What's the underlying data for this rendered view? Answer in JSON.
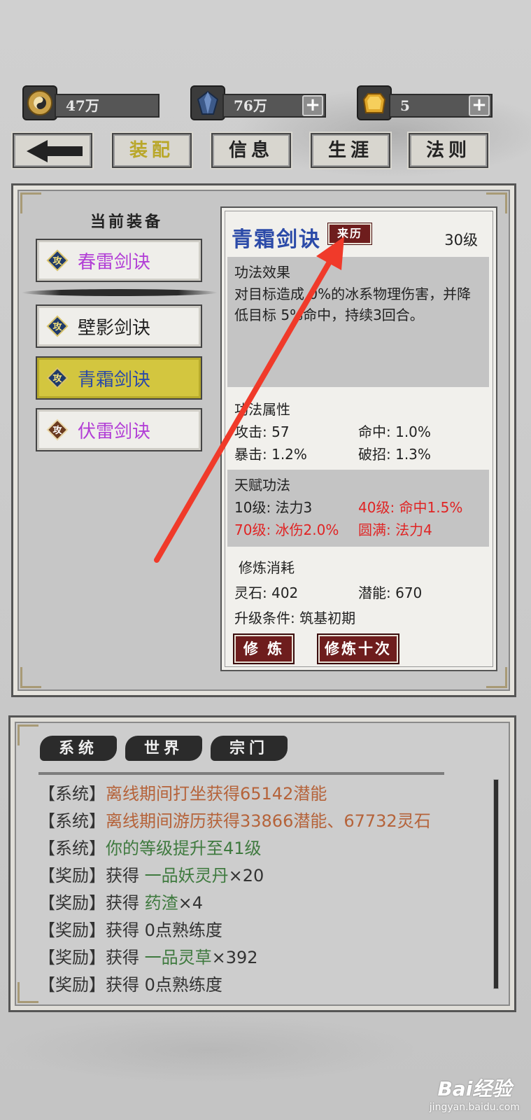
{
  "resources": [
    {
      "icon": "taiji-icon",
      "value": "47万",
      "has_plus": false
    },
    {
      "icon": "crystal-icon",
      "value": "76万",
      "has_plus": true
    },
    {
      "icon": "gold-gem-icon",
      "value": "5",
      "has_plus": true
    }
  ],
  "nav": {
    "equip": "装配",
    "info": "信息",
    "career": "生涯",
    "rules": "法则"
  },
  "equip_panel": {
    "title": "当前装备",
    "skills": [
      {
        "name": "春雷剑诀",
        "badge": "攻",
        "color": "#b23fd6",
        "selected": false
      },
      {
        "name": "壁影剑诀",
        "badge": "攻",
        "color": "#222222",
        "selected": false
      },
      {
        "name": "青霜剑诀",
        "badge": "攻",
        "color": "#2b4aa8",
        "selected": true
      },
      {
        "name": "伏雷剑诀",
        "badge": "攻",
        "color": "#b23fd6",
        "selected": false
      }
    ]
  },
  "detail": {
    "name": "青霜剑诀",
    "origin_label": "来历",
    "level": "30级",
    "effect_title": "功法效果",
    "effect_text": "对目标造成 0%的冰系物理伤害，并降低目标 5%命中，持续3回合。",
    "attr_title": "功法属性",
    "attrs": {
      "attack": "攻击: 57",
      "hit": "命中: 1.0%",
      "crit": "暴击: 1.2%",
      "break": "破招: 1.3%"
    },
    "talent_title": "天赋功法",
    "talents": {
      "t10": "10级: 法力3",
      "t40": "40级: 命中1.5%",
      "t70": "70级: 冰伤2.0%",
      "tmax": "圆满: 法力4"
    },
    "cost_title": "修炼消耗",
    "cost": {
      "stone": "灵石: 402",
      "potential": "潜能: 670",
      "requirement": "升级条件: 筑基初期"
    },
    "train_button": "修 炼",
    "train10_button": "修炼十次"
  },
  "log": {
    "tabs": [
      "系统",
      "世界",
      "宗门"
    ],
    "entries": [
      {
        "tag": "【系统】",
        "parts": [
          {
            "text": "离线期间打坐获得65142潜能",
            "style": "orange"
          }
        ]
      },
      {
        "tag": "【系统】",
        "parts": [
          {
            "text": "离线期间游历获得33866潜能、67732灵石",
            "style": "orange"
          }
        ]
      },
      {
        "tag": "【系统】",
        "parts": [
          {
            "text": "你的等级提升至41级",
            "style": "green"
          }
        ]
      },
      {
        "tag": "【奖励】",
        "parts": [
          {
            "text": "获得 ",
            "style": "dark"
          },
          {
            "text": "一品妖灵丹",
            "style": "green"
          },
          {
            "text": "×20",
            "style": "dark"
          }
        ]
      },
      {
        "tag": "【奖励】",
        "parts": [
          {
            "text": "获得 ",
            "style": "dark"
          },
          {
            "text": "药渣",
            "style": "green"
          },
          {
            "text": "×4",
            "style": "dark"
          }
        ]
      },
      {
        "tag": "【奖励】",
        "parts": [
          {
            "text": "获得 0点熟练度",
            "style": "dark"
          }
        ]
      },
      {
        "tag": "【奖励】",
        "parts": [
          {
            "text": "获得 ",
            "style": "dark"
          },
          {
            "text": "一品灵草",
            "style": "green"
          },
          {
            "text": "×392",
            "style": "dark"
          }
        ]
      },
      {
        "tag": "【奖励】",
        "parts": [
          {
            "text": "获得 0点熟练度",
            "style": "dark"
          }
        ]
      }
    ]
  },
  "watermark": {
    "line1": "Bai经验",
    "line2": "jingyan.baidu.com"
  },
  "colors": {
    "accent_red": "#6e1d1d",
    "selected_yellow": "#d3c63f",
    "annotation_arrow": "#f03a2a"
  }
}
